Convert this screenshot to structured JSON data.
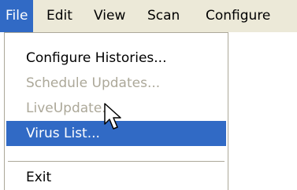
{
  "menubar": {
    "items": [
      {
        "label": "File"
      },
      {
        "label": "Edit"
      },
      {
        "label": "View"
      },
      {
        "label": "Scan"
      },
      {
        "label": "Configure"
      }
    ]
  },
  "file_menu": {
    "items": [
      {
        "label": "Configure Histories..."
      },
      {
        "label": "Schedule Updates..."
      },
      {
        "label": "LiveUpdate..."
      },
      {
        "label": "Virus List..."
      },
      {
        "label": "Exit"
      }
    ]
  },
  "colors": {
    "menubar_bg": "#ece9d8",
    "highlight": "#316ac5",
    "disabled_text": "#aca899"
  },
  "cursor_icon": "arrow-pointer-icon"
}
